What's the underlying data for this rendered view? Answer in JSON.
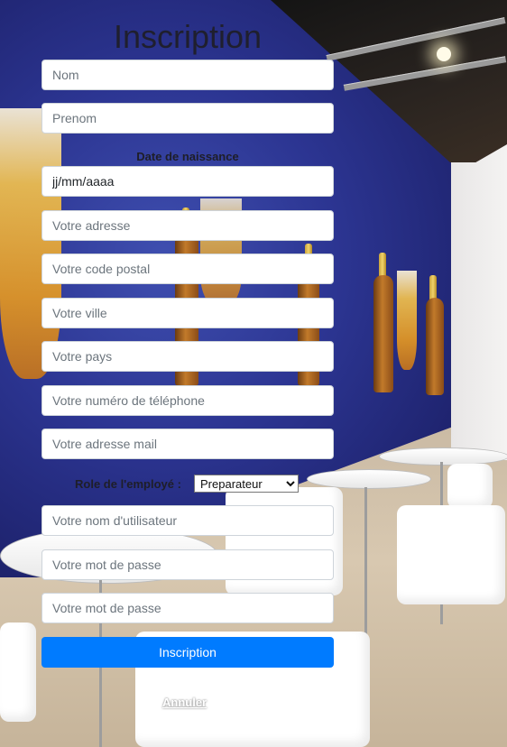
{
  "form": {
    "title": "Inscription",
    "nom_placeholder": "Nom",
    "prenom_placeholder": "Prenom",
    "date_label": "Date de naissance",
    "date_value": "jj/mm/aaaa",
    "adresse_placeholder": "Votre adresse",
    "code_postal_placeholder": "Votre code postal",
    "ville_placeholder": "Votre ville",
    "pays_placeholder": "Votre pays",
    "telephone_placeholder": "Votre numéro de téléphone",
    "mail_placeholder": "Votre adresse mail",
    "role_label": "Role de l'employé :",
    "role_selected": "Preparateur",
    "utilisateur_placeholder": "Votre nom d'utilisateur",
    "mot_de_passe_placeholder": "Votre mot de passe",
    "mot_de_passe_confirm_placeholder": "Votre mot de passe",
    "submit_label": "Inscription",
    "cancel_label": "Annuler"
  },
  "colors": {
    "primary_button": "#007bff",
    "background_wall": "#2c3592"
  }
}
